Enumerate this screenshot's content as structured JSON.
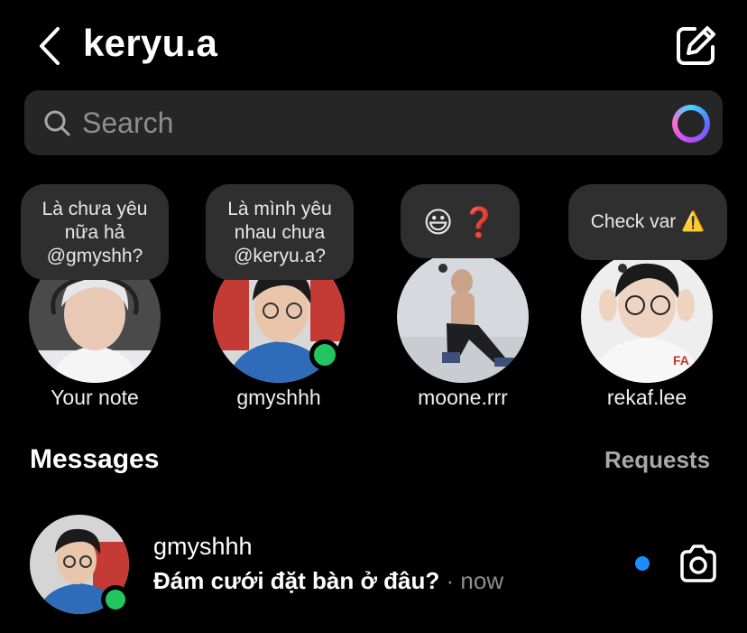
{
  "header": {
    "title": "keryu.a"
  },
  "search": {
    "placeholder": "Search"
  },
  "notes": [
    {
      "note_lines": [
        "Là chưa yêu",
        "nữa hả",
        "@gmyshh?"
      ],
      "name": "Your note"
    },
    {
      "note_lines": [
        "Là mình yêu",
        "nhau chưa",
        "@keryu.a?"
      ],
      "name": "gmyshhh",
      "online": true
    },
    {
      "note_lines": [
        "😃 ❓"
      ],
      "name": "moone.rrr"
    },
    {
      "note_lines": [
        "Check var ⚠️"
      ],
      "name": "rekaf.lee"
    }
  ],
  "messages": {
    "title": "Messages",
    "requests_label": "Requests"
  },
  "threads": [
    {
      "name": "gmyshhh",
      "message": "Đám cưới đặt bàn ở đâu?",
      "time": "· now",
      "online": true,
      "unread": true
    }
  ],
  "colors": {
    "background": "#000000",
    "search_bg": "#262626",
    "bubble_bg": "#2f2f2f",
    "online": "#22c55e",
    "unread": "#1d8cff"
  }
}
